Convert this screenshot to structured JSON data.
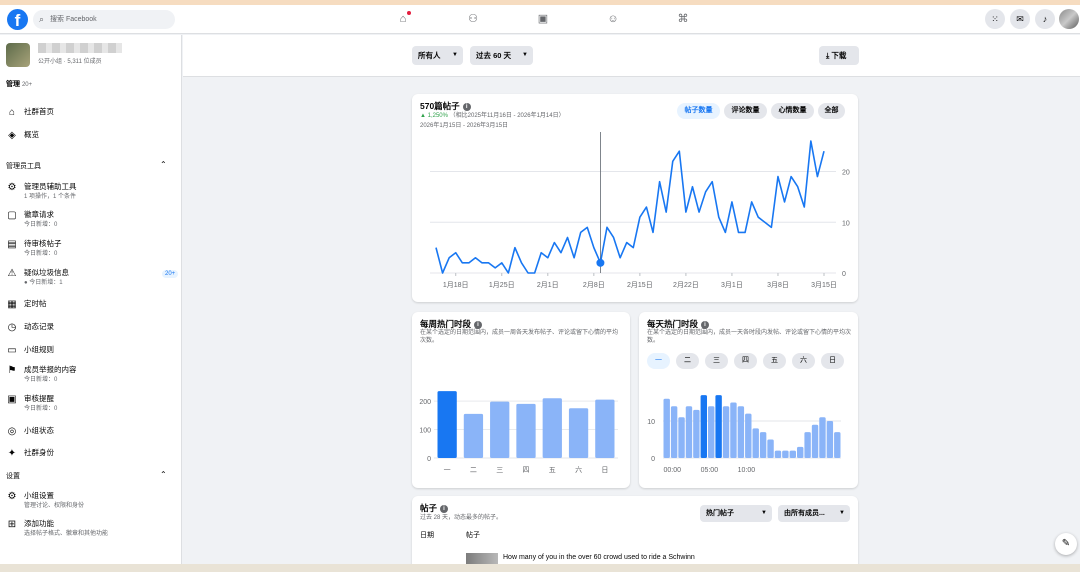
{
  "topbar": {
    "logo": "f",
    "search_placeholder": "搜索 Facebook",
    "nav_icons": [
      "home-icon",
      "friends-icon",
      "video-icon",
      "groups-icon",
      "gaming-icon"
    ],
    "right_icons": [
      "menu-grid-icon",
      "messenger-icon",
      "notifications-icon"
    ]
  },
  "sidebar": {
    "group_meta": "公开小组 · 5,311 位成员",
    "manage_label": "管理",
    "manage_count": "20+",
    "top_items": [
      {
        "label": "社群首页",
        "icon": "⌂"
      },
      {
        "label": "概览",
        "icon": "◈"
      }
    ],
    "admin_tools_heading": "管理员工具",
    "admin_items": [
      {
        "label": "管理员辅助工具",
        "sub": "1 项操作，1 个条件",
        "icon": "⚙"
      },
      {
        "label": "徽章请求",
        "sub": "今日新增：0",
        "icon": "▢"
      },
      {
        "label": "待审核帖子",
        "sub": "今日新增：0",
        "icon": "▤"
      },
      {
        "label": "疑似垃圾信息",
        "sub": "● 今日新增：1",
        "icon": "⚠",
        "badge": "20+"
      },
      {
        "label": "定时帖",
        "sub": "",
        "icon": "▦"
      },
      {
        "label": "动态记录",
        "sub": "",
        "icon": "◷"
      },
      {
        "label": "小组规则",
        "sub": "",
        "icon": "▭"
      },
      {
        "label": "成员举报的内容",
        "sub": "今日新增：0",
        "icon": "⚑"
      },
      {
        "label": "审核提醒",
        "sub": "今日新增：0",
        "icon": "▣"
      },
      {
        "label": "小组状态",
        "sub": "",
        "icon": "◎"
      },
      {
        "label": "社群身份",
        "sub": "",
        "icon": "✦"
      }
    ],
    "settings_heading": "设置",
    "settings_items": [
      {
        "label": "小组设置",
        "sub": "管理讨论、权限和身份",
        "icon": "⚙"
      },
      {
        "label": "添加功能",
        "sub": "选择帖子格式、徽章和其他功能",
        "icon": "⊞"
      }
    ]
  },
  "filters": {
    "audience": "所有人",
    "period": "过去 60 天",
    "download": "下载"
  },
  "posts_chart": {
    "title": "570篇帖子",
    "change": "▲ 1,250%",
    "compare": "（相比2025年11月16日 - 2026年1月14日）",
    "range": "2026年1月15日 - 2026年3月15日",
    "tabs": [
      "帖子数量",
      "评论数量",
      "心情数量",
      "全部"
    ]
  },
  "weekly": {
    "title": "每周热门时段",
    "desc": "在某个选定的日期范围内，成员一周各天发布帖子、评论或留下心情的平均次数。"
  },
  "daily": {
    "title": "每天热门时段",
    "desc": "在某个选定的日期范围内，成员一天各时段内发帖、评论或留下心情的平均次数。",
    "days": [
      "一",
      "二",
      "三",
      "四",
      "五",
      "六",
      "日"
    ]
  },
  "posts_list": {
    "title": "帖子",
    "desc": "过去 28 天，动态最多的帖子。",
    "sort": "热门帖子",
    "filter": "由所有成员...",
    "col_date": "日期",
    "col_post": "帖子",
    "first_row_text": "How many of you in the over 60 crowd used to ride a Schwinn"
  },
  "chart_data": [
    {
      "type": "line",
      "x": [
        "1月15日",
        "1月16日",
        "1月17日",
        "1月18日",
        "1月19日",
        "1月20日",
        "1月21日",
        "1月22日",
        "1月23日",
        "1月24日",
        "1月25日",
        "1月26日",
        "1月27日",
        "1月28日",
        "1月29日",
        "1月30日",
        "1月31日",
        "2月1日",
        "2月2日",
        "2月3日",
        "2月4日",
        "2月5日",
        "2月6日",
        "2月7日",
        "2月8日",
        "2月9日",
        "2月10日",
        "2月11日",
        "2月12日",
        "2月13日",
        "2月14日",
        "2月15日",
        "2月16日",
        "2月17日",
        "2月18日",
        "2月19日",
        "2月20日",
        "2月21日",
        "2月22日",
        "2月23日",
        "2月24日",
        "2月25日",
        "2月26日",
        "2月27日",
        "2月28日",
        "3月1日",
        "3月2日",
        "3月3日",
        "3月4日",
        "3月5日",
        "3月6日",
        "3月7日",
        "3月8日",
        "3月9日",
        "3月10日",
        "3月11日",
        "3月12日",
        "3月13日",
        "3月14日",
        "3月15日"
      ],
      "y": [
        5,
        0,
        3,
        4,
        2,
        2,
        3,
        2,
        2,
        1,
        2,
        0,
        5,
        2,
        0,
        0,
        4,
        3,
        6,
        4,
        7,
        3,
        8,
        9,
        5,
        2,
        9,
        7,
        3,
        6,
        5,
        11,
        13,
        8,
        18,
        12,
        22,
        24,
        12,
        17,
        12,
        16,
        18,
        11,
        8,
        14,
        8,
        8,
        14,
        11,
        10,
        9,
        19,
        14,
        19,
        17,
        13,
        26,
        19,
        24
      ],
      "ylim": [
        0,
        27
      ],
      "yticks": [
        0,
        10,
        20
      ],
      "xtick_labels": [
        "1月18日",
        "1月25日",
        "2月1日",
        "2月8日",
        "2月15日",
        "2月22日",
        "3月1日",
        "3月8日",
        "3月15日"
      ],
      "highlighted_index": 25,
      "grid": true,
      "color": "#1877f2"
    },
    {
      "type": "bar",
      "categories": [
        "一",
        "二",
        "三",
        "四",
        "五",
        "六",
        "日"
      ],
      "values": [
        235,
        155,
        198,
        190,
        210,
        175,
        205
      ],
      "yticks": [
        0,
        100,
        200
      ],
      "ylim": [
        0,
        260
      ],
      "highlighted_category": "一",
      "color": "#8ab4f8",
      "highlight_color": "#1877f2"
    },
    {
      "type": "bar",
      "categories": [
        "00:00",
        "01:00",
        "02:00",
        "03:00",
        "04:00",
        "05:00",
        "06:00",
        "07:00",
        "08:00",
        "09:00",
        "10:00",
        "11:00",
        "12:00",
        "13:00",
        "14:00",
        "15:00",
        "16:00",
        "17:00",
        "18:00",
        "19:00",
        "20:00",
        "21:00",
        "22:00",
        "23:00"
      ],
      "values": [
        16,
        14,
        11,
        14,
        13,
        17,
        14,
        17,
        14,
        15,
        14,
        12,
        8,
        7,
        5,
        2,
        2,
        2,
        3,
        7,
        9,
        11,
        10,
        7
      ],
      "xtick_labels": [
        "00:00",
        "05:00",
        "10:00",
        "下午 3 点",
        "晚上 8 点"
      ],
      "yticks": [
        0,
        10
      ],
      "ylim": [
        0,
        20
      ],
      "highlighted_categories": [
        "05:00",
        "07:00"
      ],
      "color": "#8ab4f8",
      "highlight_color": "#1877f2"
    }
  ]
}
